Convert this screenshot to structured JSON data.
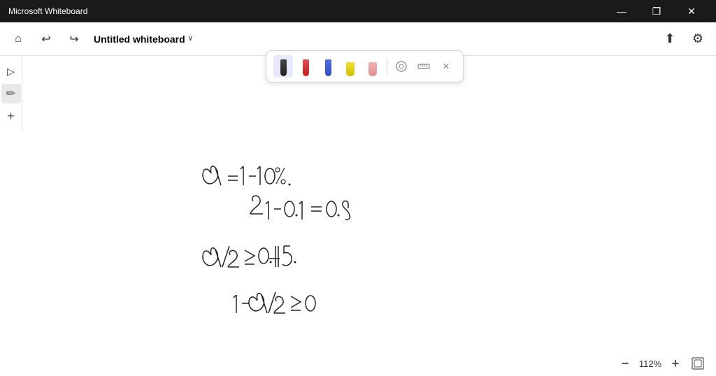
{
  "titlebar": {
    "app_name": "Microsoft Whiteboard",
    "minimize_label": "—",
    "restore_label": "❐",
    "close_label": "✕"
  },
  "menubar": {
    "home_icon": "⌂",
    "undo_icon": "↩",
    "redo_icon": "↪",
    "whiteboard_title": "Untitled whiteboard",
    "title_caret": "∨",
    "share_icon": "⬆",
    "settings_icon": "⚙"
  },
  "sidebar": {
    "select_icon": "▷",
    "pen_icon": "✏",
    "add_icon": "+"
  },
  "pen_toolbar": {
    "pens": [
      {
        "color": "#222222",
        "label": "black-pen"
      },
      {
        "color": "#e03030",
        "label": "red-pen"
      },
      {
        "color": "#3060e0",
        "label": "blue-pen"
      },
      {
        "color": "#f0e010",
        "label": "yellow-pen"
      },
      {
        "color": "#f0a0a0",
        "label": "pink-pen"
      }
    ],
    "eraser_icon": "◯",
    "ruler_icon": "▬",
    "close_icon": "✕"
  },
  "statusbar": {
    "zoom_out_icon": "−",
    "zoom_level": "112%",
    "zoom_in_icon": "+",
    "fit_icon": "⛶"
  }
}
